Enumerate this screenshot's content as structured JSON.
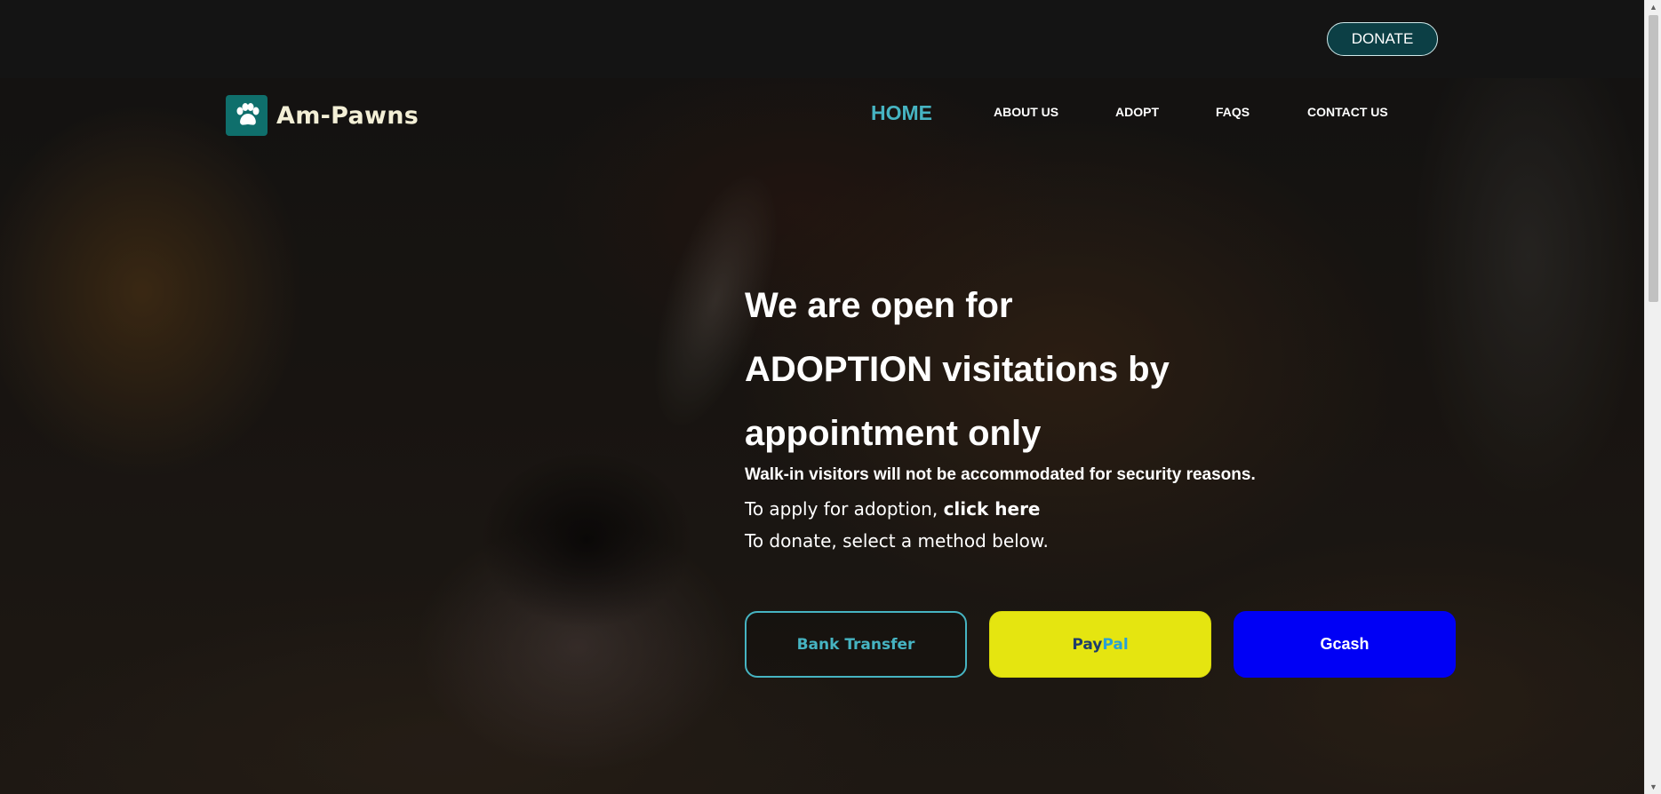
{
  "topbar": {
    "donate_label": "DONATE"
  },
  "brand": {
    "name": "Am-Pawns",
    "logo_icon": "paw-icon"
  },
  "nav": {
    "items": [
      {
        "label": "HOME",
        "active": true
      },
      {
        "label": "ABOUT US",
        "active": false
      },
      {
        "label": "ADOPT",
        "active": false
      },
      {
        "label": "FAQS",
        "active": false
      },
      {
        "label": "CONTACT US",
        "active": false
      }
    ]
  },
  "hero": {
    "headline_lines": [
      "We are open for",
      "ADOPTION visitations by",
      "appointment only"
    ],
    "walkin_notice": "Walk-in visitors will not be accommodated for security reasons.",
    "apply_prefix": "To apply for adoption, ",
    "apply_link": "click here",
    "donate_text": "To donate, select a method below."
  },
  "payment_methods": {
    "bank": "Bank Transfer",
    "paypal_part1": "Pay",
    "paypal_part2": "Pal",
    "gcash": "Gcash"
  },
  "colors": {
    "accent_teal": "#46b4c2",
    "donate_bg": "#0c3f45",
    "paypal_yellow": "#e5e510",
    "gcash_blue": "#0000f5"
  }
}
